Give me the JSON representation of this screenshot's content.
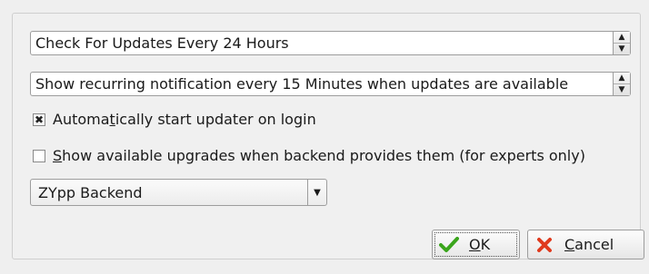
{
  "update_interval": {
    "value": "Check For Updates Every 24 Hours"
  },
  "notification_interval": {
    "value": "Show recurring notification every 15 Minutes when updates are available"
  },
  "autostart": {
    "label_pre": "Automa",
    "label_mnemonic": "t",
    "label_post": "ically start updater on login",
    "checked": true
  },
  "show_upgrades": {
    "label_mnemonic": "S",
    "label_post": "how available upgrades when backend provides them (for experts only)",
    "checked": false
  },
  "backend": {
    "selected": "ZYpp Backend"
  },
  "buttons": {
    "ok_mnemonic": "O",
    "ok_rest": "K",
    "cancel_mnemonic": "C",
    "cancel_rest": "ancel"
  },
  "colors": {
    "ok_check": "#3aa51c",
    "cancel_x": "#e03a1e"
  }
}
